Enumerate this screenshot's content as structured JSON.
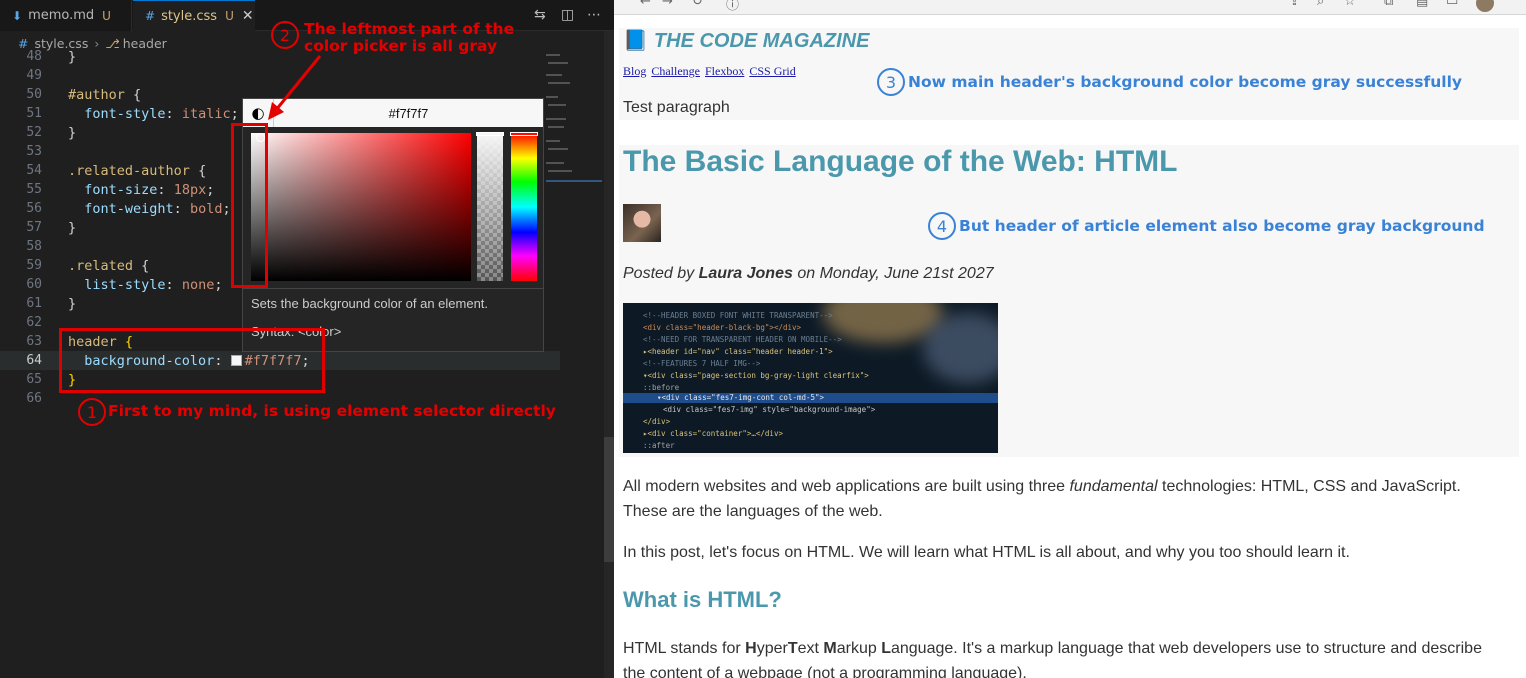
{
  "editor": {
    "tabs": [
      {
        "label": "memo.md",
        "icon": "markdown-icon",
        "status": "U"
      },
      {
        "label": "style.css",
        "icon": "css-hash-icon",
        "status": "U",
        "close": "✕"
      }
    ],
    "breadcrumb": {
      "file": "style.css",
      "symbol": "header"
    },
    "lines": [
      {
        "n": "48",
        "text": "}"
      },
      {
        "n": "49",
        "text": ""
      },
      {
        "n": "50",
        "text": "#author {"
      },
      {
        "n": "51",
        "text": "  font-style: italic;"
      },
      {
        "n": "52",
        "text": "}"
      },
      {
        "n": "53",
        "text": ""
      },
      {
        "n": "54",
        "text": ".related-author {"
      },
      {
        "n": "55",
        "text": "  font-size: 18px;"
      },
      {
        "n": "56",
        "text": "  font-weight: bold;"
      },
      {
        "n": "57",
        "text": "}"
      },
      {
        "n": "58",
        "text": ""
      },
      {
        "n": "59",
        "text": ".related {"
      },
      {
        "n": "60",
        "text": "  list-style: none;"
      },
      {
        "n": "61",
        "text": "}"
      },
      {
        "n": "62",
        "text": ""
      },
      {
        "n": "63",
        "text": "header {"
      },
      {
        "n": "64",
        "text": "  background-color: #f7f7f7;"
      },
      {
        "n": "65",
        "text": "}"
      },
      {
        "n": "66",
        "text": ""
      }
    ],
    "code": {
      "sel_author": "#author",
      "sel_related_author": ".related-author",
      "sel_related": ".related",
      "sel_header": "header",
      "open": "{",
      "close": "}",
      "p_font_style": "font-style",
      "v_italic": "italic",
      "p_font_size": "font-size",
      "v_18px": "18px",
      "p_font_weight": "font-weight",
      "v_bold": "bold",
      "p_list_style": "list-style",
      "v_none": "none",
      "p_bg": "background-color",
      "v_bg": "#f7f7f7",
      "colon": ":",
      "semi": ";"
    },
    "color_picker": {
      "hex": "#f7f7f7",
      "description": "Sets the background color of an element.",
      "syntax": "Syntax: <color>"
    }
  },
  "annotations": {
    "a1": {
      "num": "1",
      "text": "First to my mind, is using element selector directly"
    },
    "a2": {
      "num": "2",
      "line1": "The leftmost part of the",
      "line2": "color picker is all gray"
    },
    "a3": {
      "num": "3",
      "text": "Now main header's background color become gray successfully"
    },
    "a4": {
      "num": "4",
      "text": "But header of article element also become gray background"
    }
  },
  "browser": {
    "magazine_title": "THE CODE MAGAZINE",
    "nav": [
      "Blog",
      "Challenge",
      "Flexbox",
      "CSS Grid"
    ],
    "test_paragraph": "Test paragraph",
    "post_title": "The Basic Language of the Web: HTML",
    "posted_prefix": "Posted by",
    "author": "Laura Jones",
    "posted_suffix": "on Monday, June 21st 2027",
    "p1_a": "All modern websites and web applications are built using three",
    "p1_em": "fundamental",
    "p1_b": "technologies: HTML, CSS and JavaScript.",
    "p1_line2": "These are the languages of the web.",
    "p2": "In this post, let's focus on HTML. We will learn what HTML is all about, and why you too should learn it.",
    "h_what": "What is HTML?",
    "p3_a": "HTML stands for",
    "p3_H": "H",
    "p3_yper": "yper",
    "p3_T": "T",
    "p3_ext": "ext",
    "p3_M": "M",
    "p3_arkup": "arkup",
    "p3_L": "L",
    "p3_b": "anguage. It's a markup language that web developers use to structure and describe",
    "p3_line2": "the content of a webpage (not a programming language)."
  },
  "colors": {
    "accent_title": "#4b98ad",
    "header_bg": "#f7f7f7",
    "annotation_red": "#e40000",
    "annotation_blue": "#3a82d6"
  }
}
